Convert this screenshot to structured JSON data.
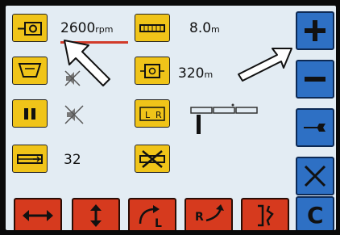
{
  "readouts": {
    "engine_speed": {
      "value": "2600",
      "unit": "rpm"
    },
    "distance_top": {
      "value": "8.0",
      "unit": "m"
    },
    "distance_mid": {
      "value": "320",
      "unit": "m"
    },
    "count": {
      "value": "32"
    }
  },
  "icons": {
    "left_column": [
      "engine-speed-icon",
      "hopper-icon",
      "pause-icon",
      "sprayer-boom-icon"
    ],
    "status": [
      "speaker-muted-icon",
      "speaker-muted-icon"
    ],
    "middle_column": [
      "boom-width-icon",
      "machine-box-icon",
      "lr-section-icon",
      "crossed-out-boom-icon"
    ],
    "right_column": [
      "plus-icon",
      "minus-icon",
      "wrench-icon",
      "x-icon",
      "c-icon"
    ],
    "bottom_row": [
      "horizontal-arrows-icon",
      "vertical-arrows-icon",
      "turn-left-icon",
      "turn-right-icon",
      "lane-split-icon"
    ]
  },
  "bottom_labels": {
    "left": "L",
    "right": "R"
  },
  "side_button_labels": {
    "clear": "C"
  },
  "section_labels": {
    "left": "L",
    "right": "R"
  },
  "colors": {
    "yellow": "#f0c419",
    "blue": "#2e70c4",
    "red": "#d63a1e",
    "screen": "#e3ecf3",
    "rpm_underline": "#d23b2a"
  }
}
